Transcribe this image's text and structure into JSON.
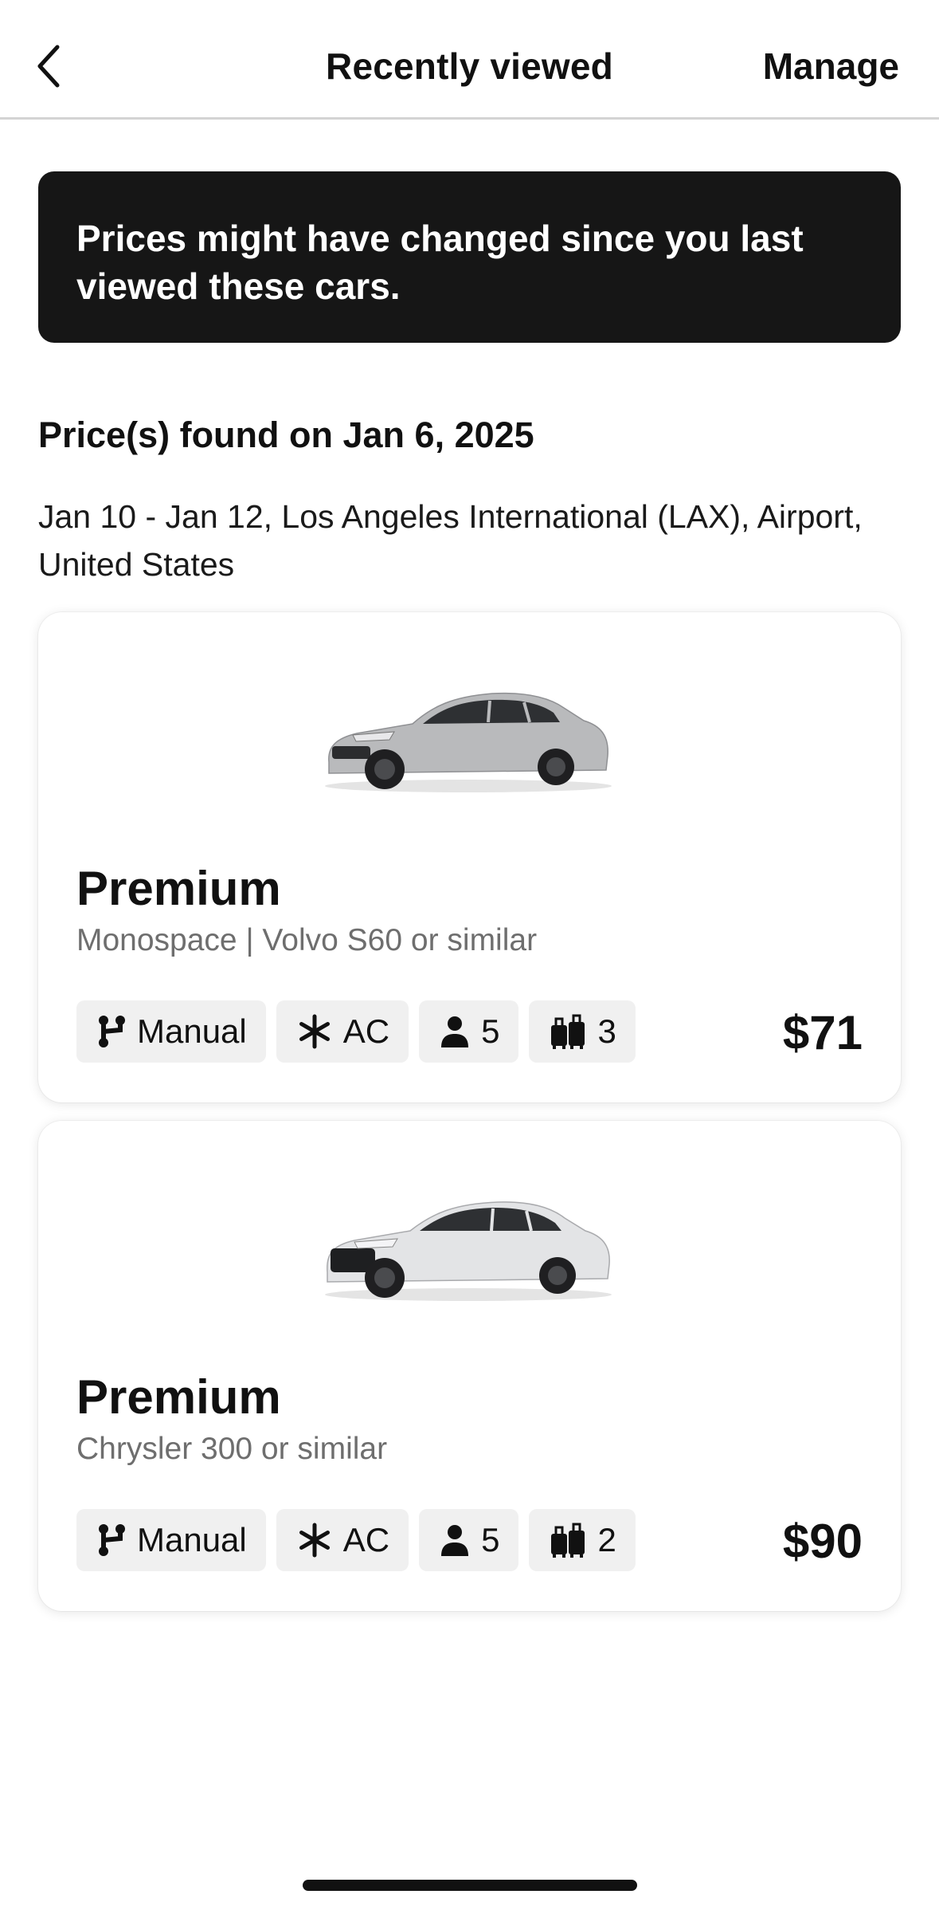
{
  "header": {
    "title": "Recently viewed",
    "manage_label": "Manage"
  },
  "notice": {
    "text": "Prices might have changed since you last viewed these cars."
  },
  "price_found": "Price(s) found on Jan 6, 2025",
  "trip": "Jan 10 - Jan 12, Los Angeles International (LAX), Airport, United States",
  "cars": [
    {
      "category": "Premium",
      "model": "Monospace | Volvo S60 or similar",
      "transmission": "Manual",
      "ac": "AC",
      "seats": "5",
      "bags": "3",
      "price": "$71",
      "color": "#b9babc"
    },
    {
      "category": "Premium",
      "model": "Chrysler 300 or similar",
      "transmission": "Manual",
      "ac": "AC",
      "seats": "5",
      "bags": "2",
      "price": "$90",
      "color": "#e3e4e6"
    }
  ]
}
